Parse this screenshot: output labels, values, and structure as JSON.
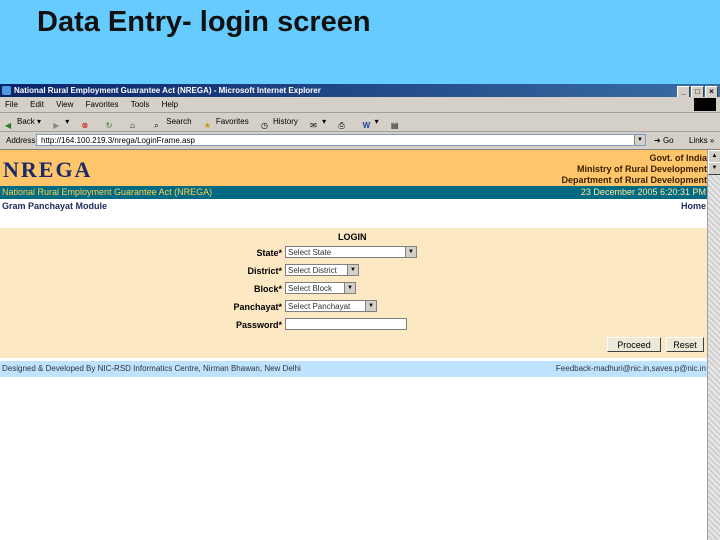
{
  "slide": {
    "title": "Data Entry- login screen"
  },
  "browser": {
    "window_title": "National Rural Employment Guarantee Act (NREGA) - Microsoft Internet Explorer",
    "window_buttons": [
      "_",
      "□",
      "×"
    ],
    "menu": [
      "File",
      "Edit",
      "View",
      "Favorites",
      "Tools",
      "Help"
    ],
    "toolbar": {
      "back": "Back",
      "search": "Search",
      "favorites": "Favorites",
      "history": "History"
    },
    "address": {
      "label": "Address",
      "url": "http://164.100.219.3/nrega/LoginFrame.asp",
      "go": "Go",
      "links": "Links »"
    }
  },
  "page": {
    "logo": "NREGA",
    "govt_lines": [
      "Govt. of India",
      "Ministry of Rural Development",
      "Department of Rural Development"
    ],
    "act_name": "National Rural Employment Guarantee Act (NREGA)",
    "datetime": "23 December 2005 6:20:31 PM",
    "module": "Gram Panchayat Module",
    "home": "Home",
    "login_title": "LOGIN",
    "fields": [
      {
        "label": "State*",
        "value": "Select State"
      },
      {
        "label": "District*",
        "value": "Select District"
      },
      {
        "label": "Block*",
        "value": "Select Block"
      },
      {
        "label": "Panchayat*",
        "value": "Select Panchayat"
      },
      {
        "label": "Password*",
        "value": ""
      }
    ],
    "buttons": {
      "proceed": "Proceed",
      "reset": "Reset"
    },
    "footer_left": "Designed & Developed By NIC-RSD Informatics Centre, Nirman Bhawan, New Delhi",
    "footer_right": "Feedback-madhuri@nic.in,saves.p@nic.in"
  },
  "colors": {
    "slide_header": "#66ccff",
    "banner": "#ffc56a",
    "act_bar": "#006a82",
    "form_bg": "#fde8c4",
    "footer": "#bde3ff"
  }
}
